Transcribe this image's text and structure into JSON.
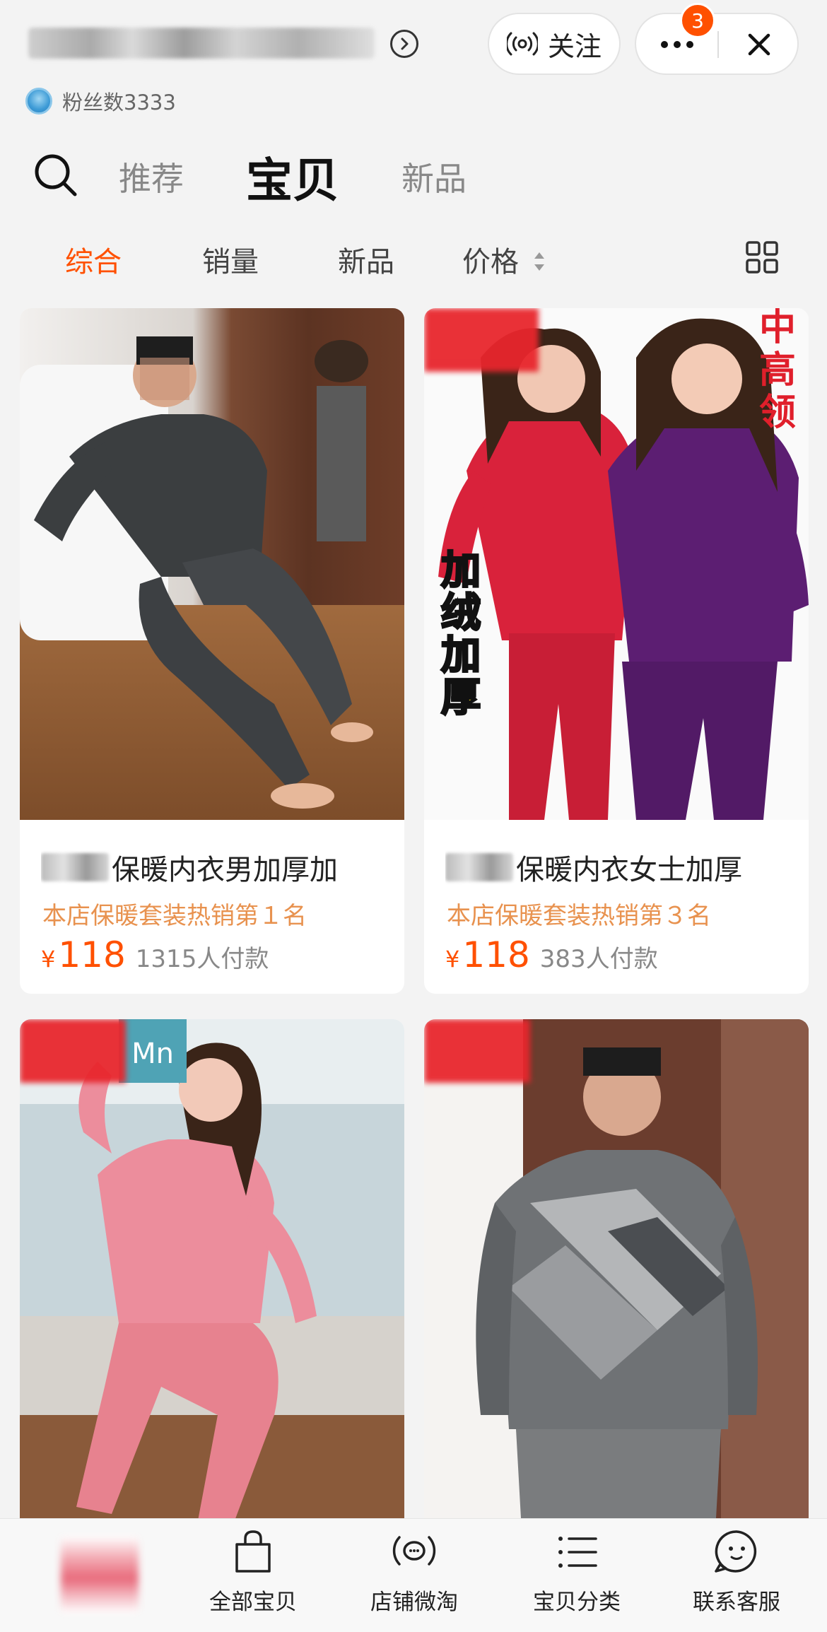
{
  "header": {
    "shop_name": "",
    "fans_label": "粉丝数3333",
    "follow_label": "关注",
    "notification_count": "3"
  },
  "tabs": {
    "recommend": "推荐",
    "items": "宝贝",
    "new": "新品"
  },
  "sort": {
    "overall": "综合",
    "sales": "销量",
    "new": "新品",
    "price": "价格"
  },
  "colors": {
    "accent": "#ff5000",
    "rank_text": "#e8924f",
    "badge_red": "#e8262d"
  },
  "products": [
    {
      "title": "保暖内衣男加厚加",
      "rank": "本店保暖套装热销第１名",
      "price_symbol": "¥",
      "price": "118",
      "paid": "1315人付款"
    },
    {
      "title": "保暖内衣女士加厚",
      "rank": "本店保暖套装热销第３名",
      "price_symbol": "¥",
      "price": "118",
      "paid": "383人付款",
      "image_text": {
        "side_top": [
          "中",
          "高",
          "领"
        ],
        "side_left": [
          "加",
          "绒",
          "加",
          "厚"
        ]
      }
    },
    {
      "image_text": {
        "brand_mark": "Mn"
      }
    },
    {}
  ],
  "bottom_bar": {
    "all_items": "全部宝贝",
    "weitao": "店铺微淘",
    "categories": "宝贝分类",
    "service": "联系客服"
  },
  "icons": {
    "follow": "broadcast-icon",
    "search": "search-icon",
    "grid": "grid-view-icon",
    "bag": "shopping-bag-icon",
    "weitao": "broadcast-chat-icon",
    "categories": "list-icon",
    "service": "chat-face-icon"
  }
}
